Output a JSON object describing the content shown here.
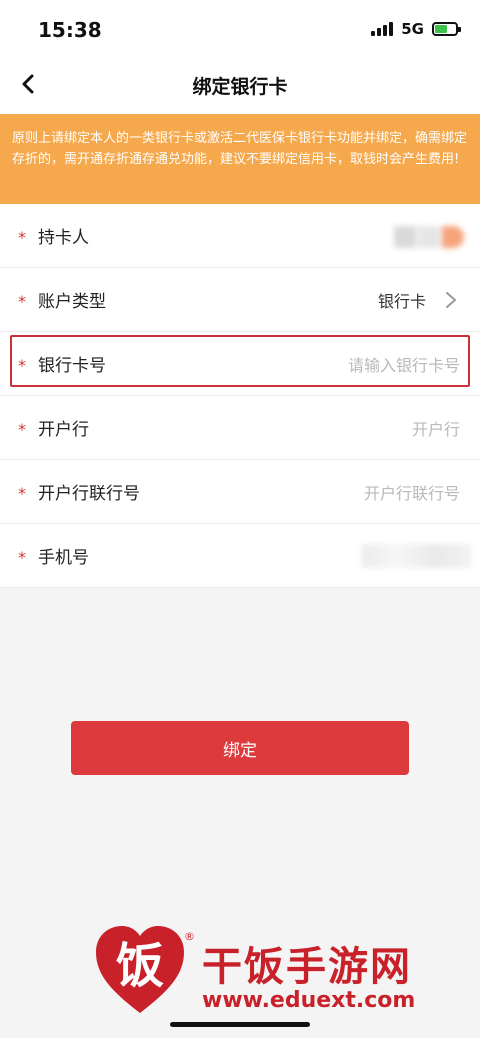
{
  "status_bar": {
    "time": "15:38",
    "network": "5G"
  },
  "nav": {
    "title": "绑定银行卡",
    "back_icon": "chevron-left-icon"
  },
  "notice": {
    "text": "原则上请绑定本人的一类银行卡或激活二代医保卡银行卡功能并绑定，确需绑定存折的，需开通存折通存通兑功能，建议不要绑定信用卡，取钱时会产生费用!",
    "color": "#f6a94c"
  },
  "form": {
    "required_mark": "*",
    "rows": [
      {
        "label": "持卡人",
        "value": ""
      },
      {
        "label": "账户类型",
        "value": "银行卡"
      },
      {
        "label": "银行卡号",
        "placeholder": "请输入银行卡号"
      },
      {
        "label": "开户行",
        "placeholder": "开户行"
      },
      {
        "label": "开户行联行号",
        "placeholder": "开户行联行号"
      },
      {
        "label": "手机号",
        "value": ""
      }
    ]
  },
  "button": {
    "label": "绑定",
    "color": "#dd3a3e"
  },
  "watermark": {
    "name": "干饭手游网",
    "url": "www.eduext.com",
    "reg": "®",
    "color": "#c9212a"
  }
}
